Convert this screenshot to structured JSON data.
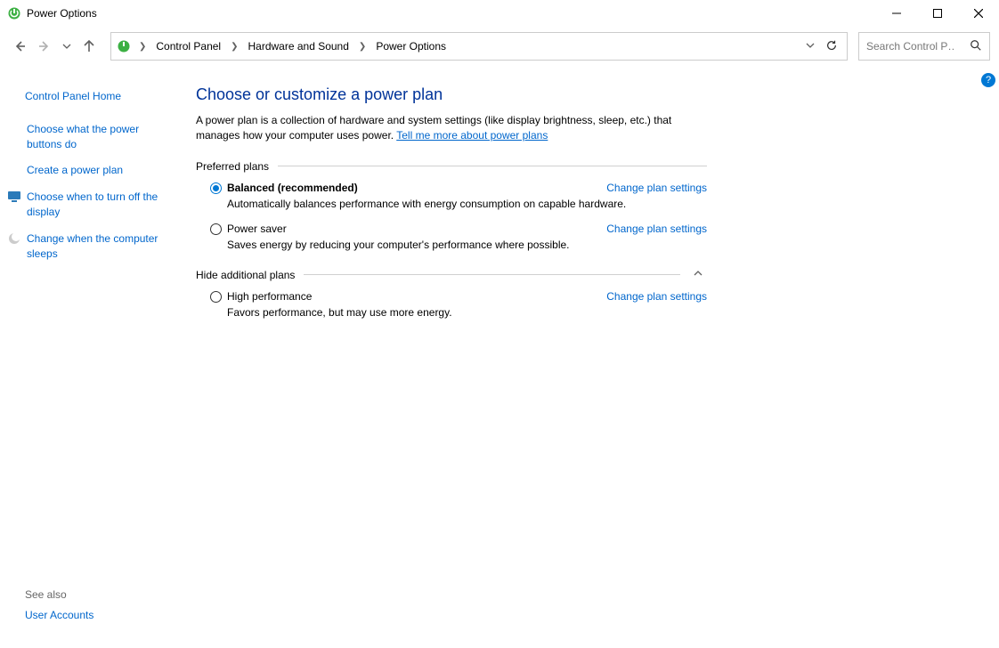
{
  "window_title": "Power Options",
  "breadcrumb": {
    "items": [
      "Control Panel",
      "Hardware and Sound",
      "Power Options"
    ]
  },
  "search": {
    "placeholder": "Search Control P…"
  },
  "sidebar": {
    "home": "Control Panel Home",
    "links": [
      {
        "label": "Choose what the power buttons do",
        "icon": false
      },
      {
        "label": "Create a power plan",
        "icon": false
      },
      {
        "label": "Choose when to turn off the display",
        "icon": true,
        "iconColor": "#2a7ab9"
      },
      {
        "label": "Change when the computer sleeps",
        "icon": true,
        "iconColor": "#777"
      }
    ],
    "see_also_title": "See also",
    "see_also": [
      "User Accounts"
    ]
  },
  "main": {
    "heading": "Choose or customize a power plan",
    "description_pre": "A power plan is a collection of hardware and system settings (like display brightness, sleep, etc.) that manages how your computer uses power. ",
    "description_link": "Tell me more about power plans",
    "preferred_title": "Preferred plans",
    "hide_title": "Hide additional plans",
    "change_link": "Change plan settings",
    "plans_preferred": [
      {
        "name": "Balanced (recommended)",
        "desc": "Automatically balances performance with energy consumption on capable hardware.",
        "selected": true
      },
      {
        "name": "Power saver",
        "desc": "Saves energy by reducing your computer's performance where possible.",
        "selected": false
      }
    ],
    "plans_additional": [
      {
        "name": "High performance",
        "desc": "Favors performance, but may use more energy.",
        "selected": false
      }
    ]
  }
}
